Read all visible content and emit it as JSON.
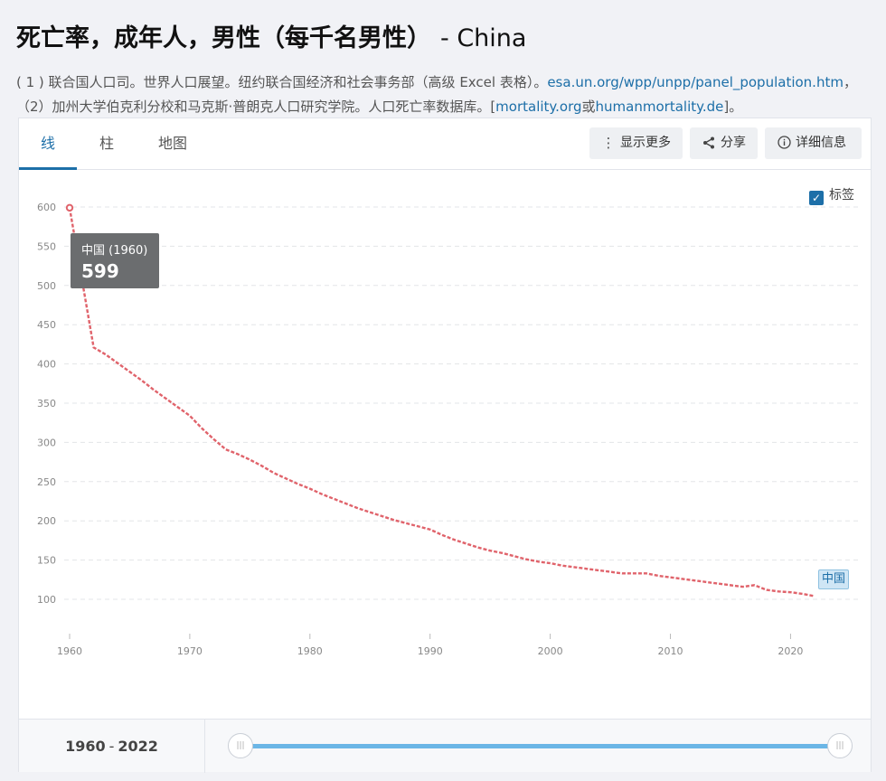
{
  "page": {
    "title": "死亡率，成年人，男性（每千名男性）",
    "title_suffix": "- China",
    "sources": {
      "line1_prefix": "( 1 ) 联合国人口司。世界人口展望。纽约联合国经济和社会事务部（高级 Excel 表格）。",
      "line1_link": "esa.un.org/wpp/unpp/panel_population.htm",
      "line1_suffix": "，",
      "line2_prefix": "（2）加州大学伯克利分校和马克斯·普朗克人口研究学院。人口死亡率数据库。[",
      "line2_link1": "mortality.org",
      "line2_or": "或",
      "line2_link2": "humanmortality.de",
      "line2_suffix": "]。"
    }
  },
  "tabs": [
    "线",
    "柱",
    "地图"
  ],
  "buttons": {
    "more": "显示更多",
    "share": "分享",
    "details": "详细信息"
  },
  "icons": {
    "more": "vertical-dots-icon",
    "share": "share-icon",
    "details": "info-icon",
    "checkbox": "checkmark-icon"
  },
  "labels_toggle": "标签",
  "tooltip": {
    "name": "中国 (1960)",
    "value": "599"
  },
  "series_tag": "中国",
  "range": {
    "start": "1960",
    "end": "2022"
  },
  "colors": {
    "line": "#e0636b",
    "accent": "#1d6fa8",
    "slider": "#6bb6e6"
  },
  "chart_data": {
    "type": "line",
    "title": "死亡率，成年人，男性（每千名男性）",
    "xlabel": "",
    "ylabel": "",
    "ylim": [
      100,
      600
    ],
    "xlim": [
      1960,
      2022
    ],
    "yticks": [
      100,
      150,
      200,
      250,
      300,
      350,
      400,
      450,
      500,
      550,
      600
    ],
    "xticks": [
      1960,
      1970,
      1980,
      1990,
      2000,
      2010,
      2020
    ],
    "grid": true,
    "series": [
      {
        "name": "中国",
        "x": [
          1960,
          1962,
          1963,
          1964,
          1965,
          1966,
          1967,
          1968,
          1969,
          1970,
          1971,
          1972,
          1973,
          1974,
          1975,
          1976,
          1977,
          1978,
          1979,
          1980,
          1981,
          1982,
          1983,
          1984,
          1985,
          1986,
          1987,
          1988,
          1989,
          1990,
          1991,
          1992,
          1993,
          1994,
          1995,
          1996,
          1997,
          1998,
          1999,
          2000,
          2001,
          2002,
          2003,
          2004,
          2005,
          2006,
          2007,
          2008,
          2009,
          2010,
          2011,
          2012,
          2013,
          2014,
          2015,
          2016,
          2017,
          2018,
          2019,
          2020,
          2021,
          2022
        ],
        "values": [
          599,
          421,
          412,
          401,
          390,
          379,
          367,
          356,
          345,
          334,
          318,
          304,
          291,
          285,
          278,
          270,
          261,
          254,
          247,
          241,
          234,
          228,
          222,
          216,
          211,
          206,
          201,
          197,
          193,
          189,
          182,
          176,
          171,
          166,
          162,
          159,
          155,
          151,
          148,
          146,
          143,
          141,
          139,
          137,
          135,
          133,
          133,
          133,
          130,
          128,
          126,
          124,
          122,
          120,
          118,
          116,
          118,
          112,
          110,
          109,
          107,
          104
        ]
      }
    ]
  }
}
